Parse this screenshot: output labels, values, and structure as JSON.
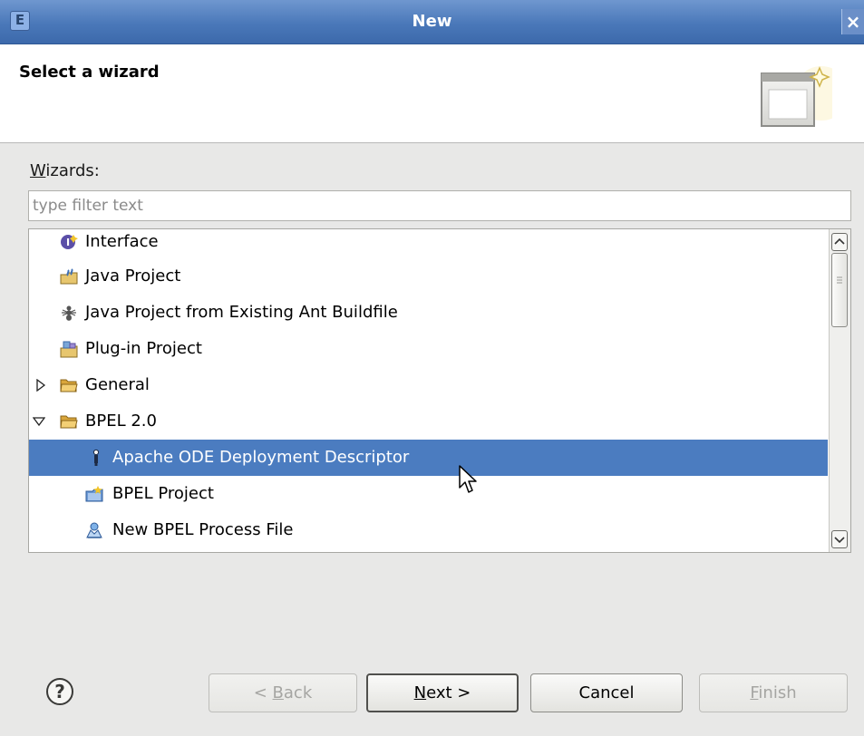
{
  "window": {
    "title": "New",
    "close_label": "×",
    "app_icon_letter": "E"
  },
  "header": {
    "title": "Select a wizard",
    "banner_icon": "new-wizard-banner-icon"
  },
  "wizards": {
    "label_underlined": "W",
    "label_rest": "izards:",
    "filter_placeholder": "type filter text"
  },
  "tree": {
    "items": [
      {
        "label": "Interface",
        "icon": "interface-icon"
      },
      {
        "label": "Java Project",
        "icon": "java-project-icon"
      },
      {
        "label": "Java Project from Existing Ant Buildfile",
        "icon": "ant-icon"
      },
      {
        "label": "Plug-in Project",
        "icon": "plugin-project-icon"
      },
      {
        "label": "General",
        "icon": "folder-icon",
        "expanded": false
      },
      {
        "label": "BPEL 2.0",
        "icon": "folder-icon",
        "expanded": true
      },
      {
        "label": "Apache ODE Deployment Descriptor",
        "icon": "deployment-descriptor-icon",
        "selected": true
      },
      {
        "label": "BPEL Project",
        "icon": "bpel-project-icon"
      },
      {
        "label": "New BPEL Process File",
        "icon": "bpel-process-icon"
      }
    ]
  },
  "buttons": {
    "back_prefix": "< ",
    "back_mnemonic": "B",
    "back_rest": "ack",
    "next_mnemonic": "N",
    "next_rest": "ext >",
    "cancel": "Cancel",
    "finish_mnemonic": "F",
    "finish_rest": "inish"
  },
  "colors": {
    "selection": "#4b7cc0",
    "titlebar": "#4a78b9"
  }
}
